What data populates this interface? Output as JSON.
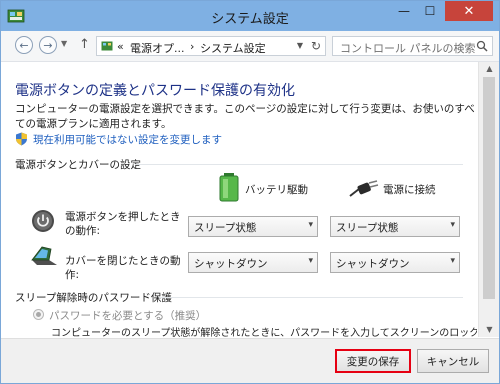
{
  "window": {
    "title": "システム設定"
  },
  "nav": {
    "breadcrumbs": [
      "«",
      "電源オプ...",
      "›",
      "システム設定"
    ],
    "search_placeholder": "コントロール パネルの検索"
  },
  "page": {
    "heading": "電源ボタンの定義とパスワード保護の有効化",
    "description": "コンピューターの電源設定を選択できます。このページの設定に対して行う変更は、お使いのすべての電源プランに適用されます。",
    "change_settings_link": "現在利用可能ではない設定を変更します"
  },
  "power_section": {
    "header": "電源ボタンとカバーの設定",
    "battery_label": "バッテリ駆動",
    "plugged_label": "電源に接続",
    "rows": [
      {
        "label": "電源ボタンを押したときの動作:",
        "battery": "スリープ状態",
        "plugged": "スリープ状態"
      },
      {
        "label": "カバーを閉じたときの動作:",
        "battery": "シャットダウン",
        "plugged": "シャットダウン"
      }
    ]
  },
  "password_section": {
    "header": "スリープ解除時のパスワード保護",
    "option_label": "パスワードを必要とする（推奨）",
    "option_desc": "コンピューターのスリープ状態が解除されたときに、パスワードを入力してスクリーンのロックを解除しない限"
  },
  "footer": {
    "save_label": "変更の保存",
    "cancel_label": "キャンセル"
  },
  "colors": {
    "titlebar": "#7fb0e3",
    "heading": "#1e3287",
    "link": "#1f5fbf",
    "close": "#c7443b",
    "highlight": "#e60012"
  }
}
